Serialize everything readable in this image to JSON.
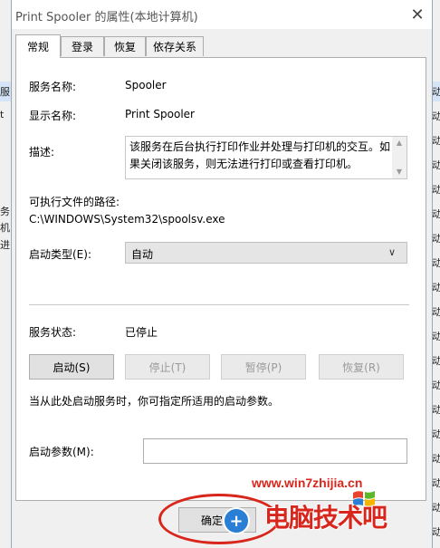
{
  "background": {
    "left_fragments": [
      {
        "text": "服",
        "row": 0
      },
      {
        "text": "t",
        "row": 1
      },
      {
        "text": "务",
        "row": 2
      },
      {
        "text": "机",
        "row": 3
      },
      {
        "text": "进",
        "row": 4
      }
    ],
    "right_fragments": [
      "动",
      "动",
      "动",
      "动",
      "动",
      "动",
      "动",
      "动",
      "动",
      "动",
      "动",
      "动",
      "动",
      "动",
      "动",
      "动",
      "动",
      "动",
      "动"
    ]
  },
  "dialog": {
    "title": "Print Spooler 的属性(本地计算机)",
    "close_icon": "close-icon",
    "tabs": [
      {
        "label": "常规",
        "active": true
      },
      {
        "label": "登录",
        "active": false
      },
      {
        "label": "恢复",
        "active": false
      },
      {
        "label": "依存关系",
        "active": false
      }
    ],
    "general": {
      "service_name_label": "服务名称:",
      "service_name_value": "Spooler",
      "display_name_label": "显示名称:",
      "display_name_value": "Print Spooler",
      "description_label": "描述:",
      "description_value": "该服务在后台执行打印作业并处理与打印机的交互。如果关闭该服务，则无法进行打印或查看打印机。",
      "path_label": "可执行文件的路径:",
      "path_value": "C:\\WINDOWS\\System32\\spoolsv.exe",
      "startup_type_label": "启动类型(E):",
      "startup_type_value": "自动",
      "service_status_label": "服务状态:",
      "service_status_value": "已停止",
      "buttons": {
        "start": "启动(S)",
        "stop": "停止(T)",
        "pause": "暂停(P)",
        "resume": "恢复(R)"
      },
      "hint": "当从此处启动服务时，你可指定所适用的启动参数。",
      "start_params_label": "启动参数(M):",
      "start_params_value": ""
    },
    "ok_button": "确定"
  },
  "watermark": {
    "url": "www.win7zhijia.cn",
    "brand": "电脑技术吧",
    "logo_glyph": "+",
    "colors": {
      "red": "#d9261c",
      "blue": "#2a7fd4"
    }
  },
  "colors": {
    "dialog_bg": "#f0f0f0",
    "panel_bg": "#ffffff",
    "highlight_ring": "#d9261c"
  }
}
